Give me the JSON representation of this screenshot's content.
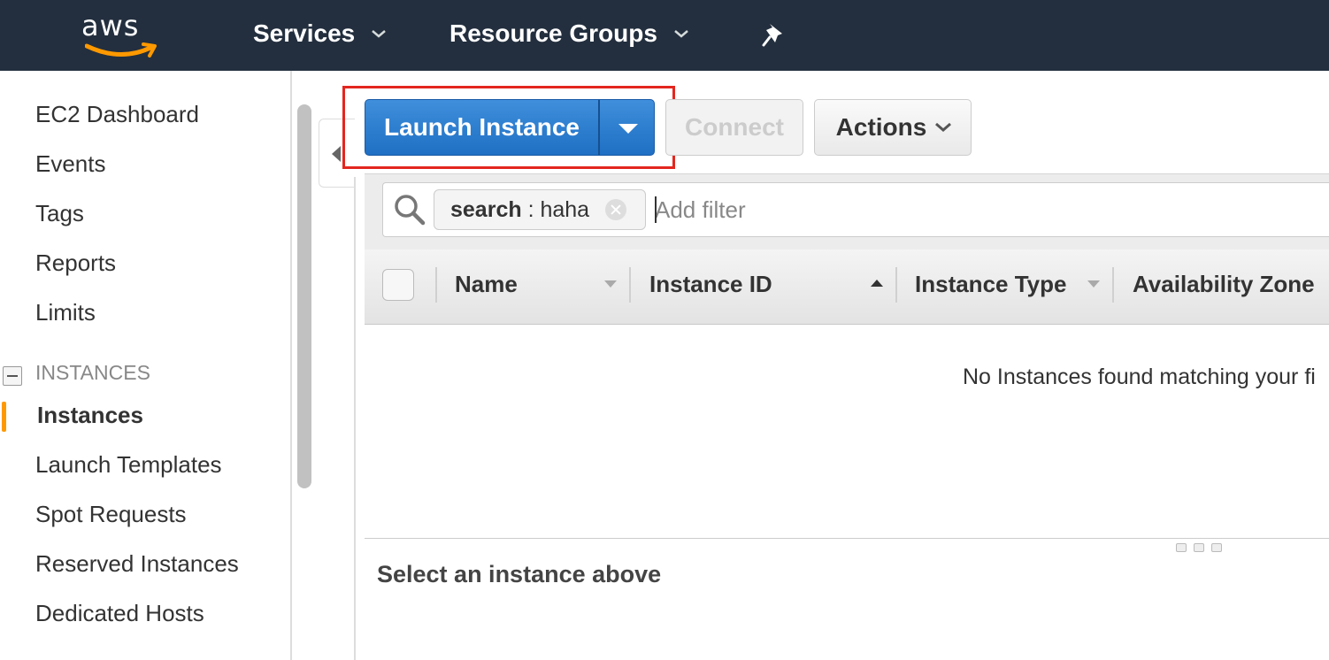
{
  "topnav": {
    "logo_text": "aws",
    "services_label": "Services",
    "resource_groups_label": "Resource Groups",
    "icons": [
      "chevron-down-icon",
      "pin-icon"
    ]
  },
  "sidebar": {
    "links": [
      "EC2 Dashboard",
      "Events",
      "Tags",
      "Reports",
      "Limits"
    ],
    "section_title": "INSTANCES",
    "section_items": [
      "Instances",
      "Launch Templates",
      "Spot Requests",
      "Reserved Instances",
      "Dedicated Hosts"
    ],
    "active_item": "Instances"
  },
  "toolbar": {
    "launch_label": "Launch Instance",
    "connect_label": "Connect",
    "actions_label": "Actions"
  },
  "search": {
    "token_key": "search",
    "token_sep": " : ",
    "token_value": "haha",
    "placeholder": "Add filter"
  },
  "table": {
    "columns": [
      "Name",
      "Instance ID",
      "Instance Type",
      "Availability Zone"
    ],
    "sorted_column": "Instance ID",
    "empty_message": "No Instances found matching your fi"
  },
  "details": {
    "title": "Select an instance above"
  },
  "colors": {
    "topbar": "#232f3e",
    "primary_button": "#1f6fc4",
    "active_indicator": "#ff9900",
    "highlight_box": "#e3261f"
  }
}
